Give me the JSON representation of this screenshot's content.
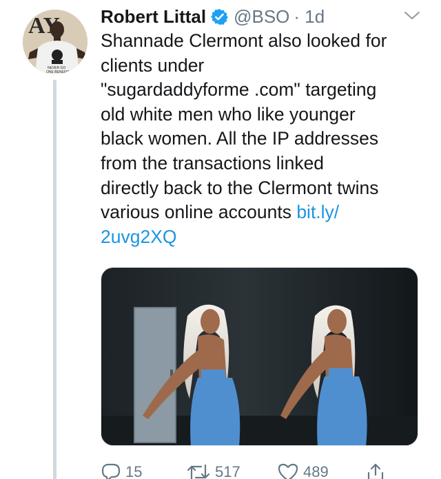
{
  "author": {
    "name": "Robert Littal",
    "handle": "@BSO",
    "time": "· 1d"
  },
  "tweet": {
    "text_line1": "Shannade Clermont also looked for",
    "text_line2": "clients under",
    "text_line3": "\"sugardaddyforme .com\" targeting",
    "text_line4": "old white men who like younger",
    "text_line5": "black women. All the IP addresses",
    "text_line6": "from the transactions linked",
    "text_line7": "directly back to the Clermont twins",
    "text_line8": "various online accounts ",
    "link_part1": "bit.ly/",
    "link_part2": "2uvg2XQ"
  },
  "avatar": {
    "letters": "AY",
    "shirt_text_1": "NEVER GO",
    "shirt_text_2": "ONE BENEFIT"
  },
  "actions": {
    "replies": "15",
    "retweets": "517",
    "likes": "489"
  },
  "colors": {
    "link": "#1b95e0",
    "verified": "#1da1f2",
    "meta": "#657786",
    "thread_line": "#cfd9de",
    "outfit": "#4f8fd0"
  },
  "icons": {
    "verified": "verified-badge-icon",
    "menu": "chevron-down-icon",
    "reply": "reply-icon",
    "retweet": "retweet-icon",
    "like": "heart-icon",
    "share": "share-icon"
  }
}
